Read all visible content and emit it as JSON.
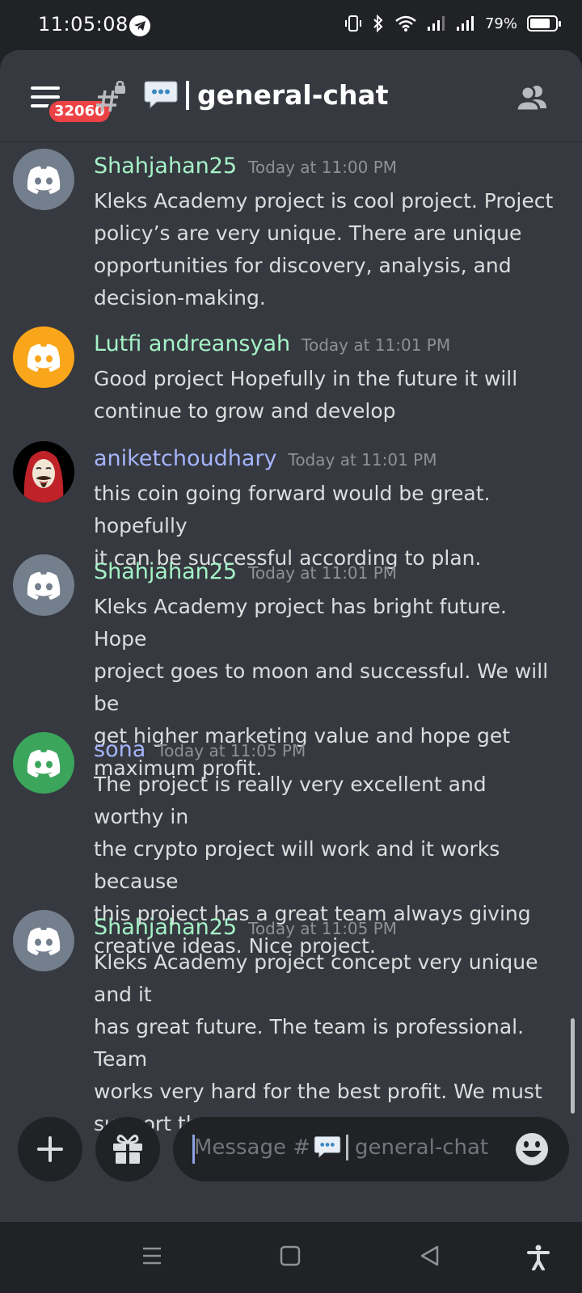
{
  "status_bar": {
    "time": "11:05:08",
    "battery": "79%",
    "battery_level": 0.79
  },
  "header": {
    "notification_badge": "32060",
    "channel_name": "general-chat",
    "icons": [
      "menu-icon",
      "locked-hash-icon",
      "speech-bubble-icon",
      "members-icon"
    ]
  },
  "messages": [
    {
      "author": "Shahjahan25",
      "author_color": "#a5f3c8",
      "avatar": {
        "type": "discord-logo",
        "color": "#747f8d"
      },
      "timestamp": "Today at 11:00 PM",
      "text": "Kleks Academy project is cool project. Project\npolicy’s are very unique. There are unique\nopportunities for discovery, analysis, and\ndecision-making."
    },
    {
      "author": "Lutfi andreansyah",
      "author_color": "#a5f3c8",
      "avatar": {
        "type": "discord-logo",
        "color": "#faa61a"
      },
      "timestamp": "Today at 11:01 PM",
      "text": "Good project Hopefully in the future it will\ncontinue to grow and develop"
    },
    {
      "author": "aniketchoudhary",
      "author_color": "#a5b4fc",
      "avatar": {
        "type": "photo-mask",
        "color": "#000000"
      },
      "timestamp": "Today at 11:01 PM",
      "text": "this coin going forward would be great. hopefully\nit can be successful according to plan."
    },
    {
      "author": "Shahjahan25",
      "author_color": "#a5f3c8",
      "avatar": {
        "type": "discord-logo",
        "color": "#747f8d"
      },
      "timestamp": "Today at 11:01 PM",
      "text": "Kleks Academy project has bright future. Hope\nproject goes to moon and successful.  We will be\nget higher marketing value and hope get\nmaximum profit."
    },
    {
      "author": "sona",
      "author_color": "#a5b4fc",
      "avatar": {
        "type": "discord-logo",
        "color": "#3ba55c"
      },
      "timestamp": "Today at 11:05 PM",
      "text": "The project is really very excellent and worthy in\nthe crypto  project will work and it works because\nthis project has a great team always giving\ncreative ideas. Nice project."
    },
    {
      "author": "Shahjahan25",
      "author_color": "#a5f3c8",
      "avatar": {
        "type": "discord-logo",
        "color": "#747f8d"
      },
      "timestamp": "Today at 11:05 PM",
      "text": "Kleks Academy project concept very unique and it\nhas great future. The team is professional. Team\nworks very hard for the best profit. We must\nsupport them."
    }
  ],
  "composer": {
    "placeholder_prefix": "Message #",
    "placeholder_channel": "general-chat",
    "icons": [
      "plus-icon",
      "gift-icon",
      "emoji-icon"
    ]
  },
  "nav_bar": {
    "icons": [
      "recents-icon",
      "home-icon",
      "back-icon",
      "accessibility-icon"
    ]
  },
  "colors": {
    "background": "#36393f",
    "header": "#36393f",
    "input": "#202225",
    "badge": "#ed4245"
  }
}
